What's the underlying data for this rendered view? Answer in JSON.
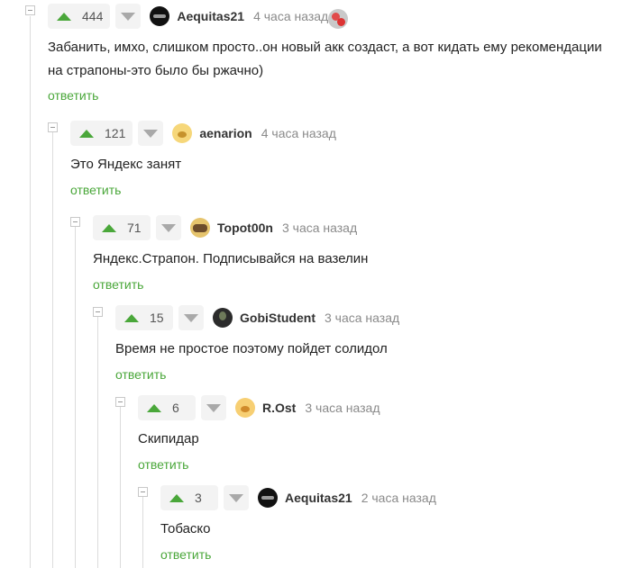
{
  "comments": [
    {
      "votes": "444",
      "user": "Aequitas21",
      "time": "4 часа назад",
      "text_lines": [
        "Забанить, имхо, слишком просто..он новый акк создаст, а вот кидать ему рекомендации",
        "на страпоны-это было бы ржачно)"
      ],
      "reply": "ответить"
    },
    {
      "votes": "121",
      "user": "aenarion",
      "time": "4 часа назад",
      "text_lines": [
        "Это Яндекс занят"
      ],
      "reply": "ответить"
    },
    {
      "votes": "71",
      "user": "Topot00n",
      "time": "3 часа назад",
      "text_lines": [
        "Яндекс.Страпон. Подписывайся на вазелин"
      ],
      "reply": "ответить"
    },
    {
      "votes": "15",
      "user": "GobiStudent",
      "time": "3 часа назад",
      "text_lines": [
        "Время не простое поэтому пойдет солидол"
      ],
      "reply": "ответить"
    },
    {
      "votes": "6",
      "user": "R.Ost",
      "time": "3 часа назад",
      "text_lines": [
        "Скипидар"
      ],
      "reply": "ответить"
    },
    {
      "votes": "3",
      "user": "Aequitas21",
      "time": "2 часа назад",
      "text_lines": [
        "Тобаско"
      ],
      "reply": "ответить"
    }
  ],
  "icons": {
    "upvote": "arrow-up-icon",
    "downvote": "arrow-down-icon",
    "collapse": "minus-square-icon",
    "award": "badge-icon"
  },
  "colors": {
    "upvote": "#4aa73a",
    "reply": "#4aa73a",
    "downvote": "#a9a9a9",
    "thread_line": "#dcdcdc"
  }
}
